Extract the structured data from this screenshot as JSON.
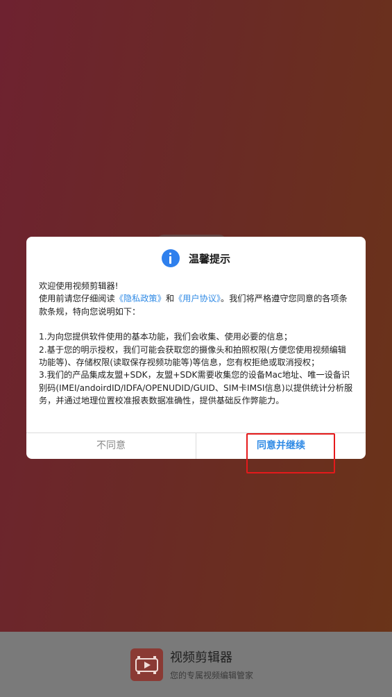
{
  "dialog": {
    "title": "温馨提示",
    "intro_line1": "欢迎使用视频剪辑器!",
    "intro_line2_pre": "使用前请您仔细阅读",
    "privacy_link": "《隐私政策》",
    "and_text": "和",
    "terms_link": "《用户协议》",
    "intro_line2_post": "。我们将严格遵守您同意的各项条款条规，特向您说明如下：",
    "point1": "1.为向您提供软件使用的基本功能，我们会收集、使用必要的信息；",
    "point2": " 2.基于您的明示授权，我们可能会获取您的摄像头和拍照权限(方便您使用视频编辑功能等)、存储权限(读取保存视频功能等)等信息，您有权拒绝或取消授权；",
    "point3": " 3.我们的产品集成友盟+SDK，友盟+SDK需要收集您的设备Mac地址、唯一设备识别码(IMEI/andoirdID/IDFA/OPENUDID/GUID、SIM卡IMSI信息)以提供统计分析服务，并通过地理位置校准报表数据准确性，提供基础反作弊能力。",
    "decline_label": "不同意",
    "accept_label": "同意并继续"
  },
  "footer": {
    "app_name": "视频剪辑器",
    "app_tagline": "您的专属视频编辑管家"
  },
  "colors": {
    "accent": "#2f8ae5",
    "highlight": "#e5191b"
  }
}
